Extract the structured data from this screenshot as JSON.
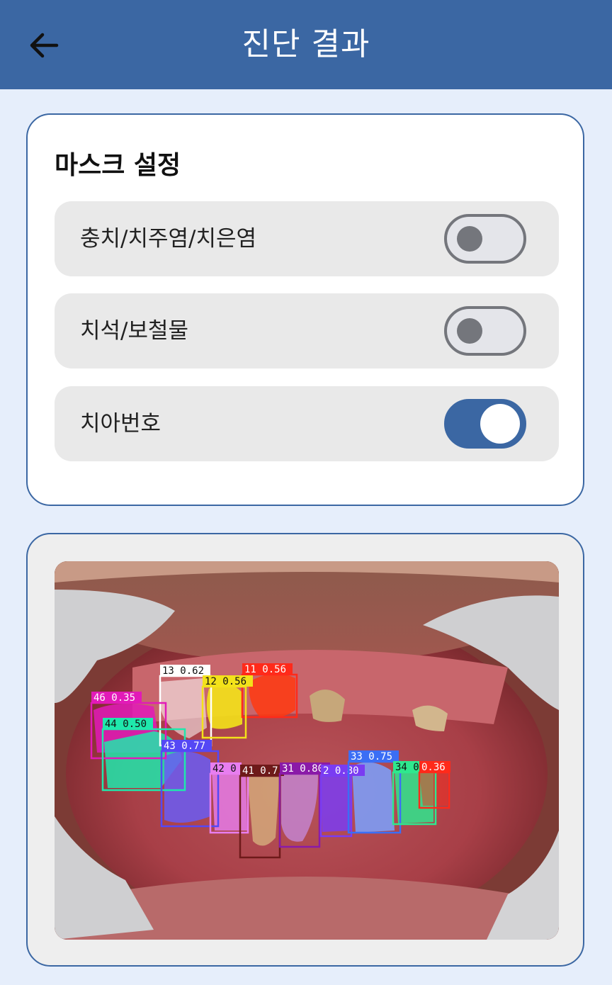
{
  "header": {
    "title": "진단 결과",
    "back_icon": "arrow-left-icon"
  },
  "mask_settings": {
    "title": "마스크 설정",
    "options": [
      {
        "label": "충치/치주염/치은염",
        "enabled": false
      },
      {
        "label": "치석/보철물",
        "enabled": false
      },
      {
        "label": "치아번호",
        "enabled": true
      }
    ]
  },
  "detections": [
    {
      "label": "13 0.62",
      "color": "#ffffff"
    },
    {
      "label": "11 0.56",
      "color": "#ff2a1a"
    },
    {
      "label": "12 0.56",
      "color": "#f3e21a"
    },
    {
      "label": "46 0.35",
      "color": "#e21ab8"
    },
    {
      "label": "44 0.50",
      "color": "#1fe8ac"
    },
    {
      "label": "43 0.77",
      "color": "#5548f5"
    },
    {
      "label": "42 0",
      "color": "#e87ef0"
    },
    {
      "label": "41 0.7",
      "color": "#6e1a1a"
    },
    {
      "label": "31 0.80",
      "color": "#8a1aa8"
    },
    {
      "label": "2 0.80",
      "color": "#7a3cf2"
    },
    {
      "label": "33 0.75",
      "color": "#3b6ef5"
    },
    {
      "label": "34 0.70",
      "color": "#2ee88e"
    },
    {
      "label": "0.36",
      "color": "#ff2a1a"
    }
  ],
  "colors": {
    "primary": "#3b67a3",
    "background": "#e6eefb"
  }
}
